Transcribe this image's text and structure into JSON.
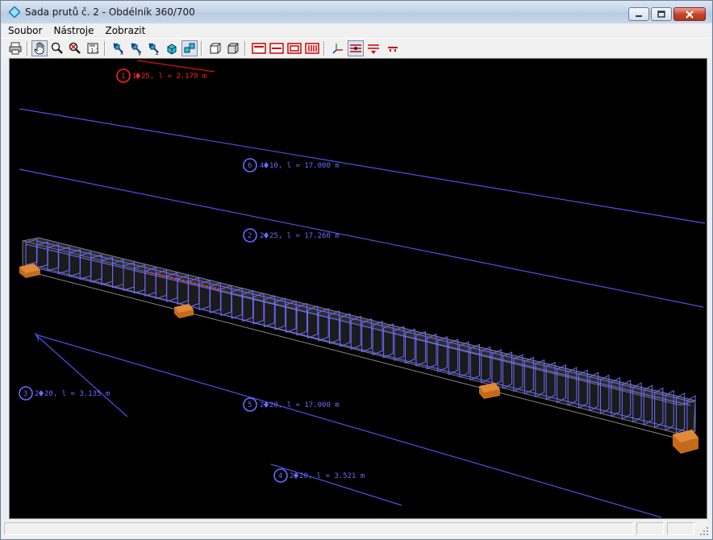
{
  "window": {
    "title": "Sada prutů č. 2 - Obdélník 360/700",
    "buttons": [
      "minimize",
      "maximize",
      "close"
    ]
  },
  "menu": [
    "Soubor",
    "Nástroje",
    "Zobrazit"
  ],
  "toolbar": [
    "print-icon",
    "pan-icon",
    "zoom-icon",
    "zoom-reset-icon",
    "save-view-icon",
    "view-x-icon",
    "view-y-icon",
    "view-z-icon",
    "view-iso-icon",
    "view-3d-icon",
    "box-front-icon",
    "box-back-icon",
    "section-top-icon",
    "section-middle-icon",
    "section-frame-icon",
    "section-stirrups-icon",
    "axes-icon",
    "layers-icon",
    "layers-filter-icon",
    "support-icon"
  ],
  "bars": [
    {
      "label": "1",
      "text": "1",
      "desc": "25, l = 2.179 m",
      "color": "#ff2020"
    },
    {
      "label": "6",
      "text": "4",
      "desc": "10, l = 17.000 m",
      "color": "#6b6bff"
    },
    {
      "label": "2",
      "text": "2",
      "desc": "25, l = 17.260 m",
      "color": "#6b6bff"
    },
    {
      "label": "3",
      "text": "2",
      "desc": "20, l = 3.135 m",
      "color": "#6b6bff"
    },
    {
      "label": "5",
      "text": "2",
      "desc": "20, l = 17.000 m",
      "color": "#6b6bff"
    },
    {
      "label": "4",
      "text": "2",
      "desc": "20, l = 3.521 m",
      "color": "#6b6bff"
    }
  ]
}
